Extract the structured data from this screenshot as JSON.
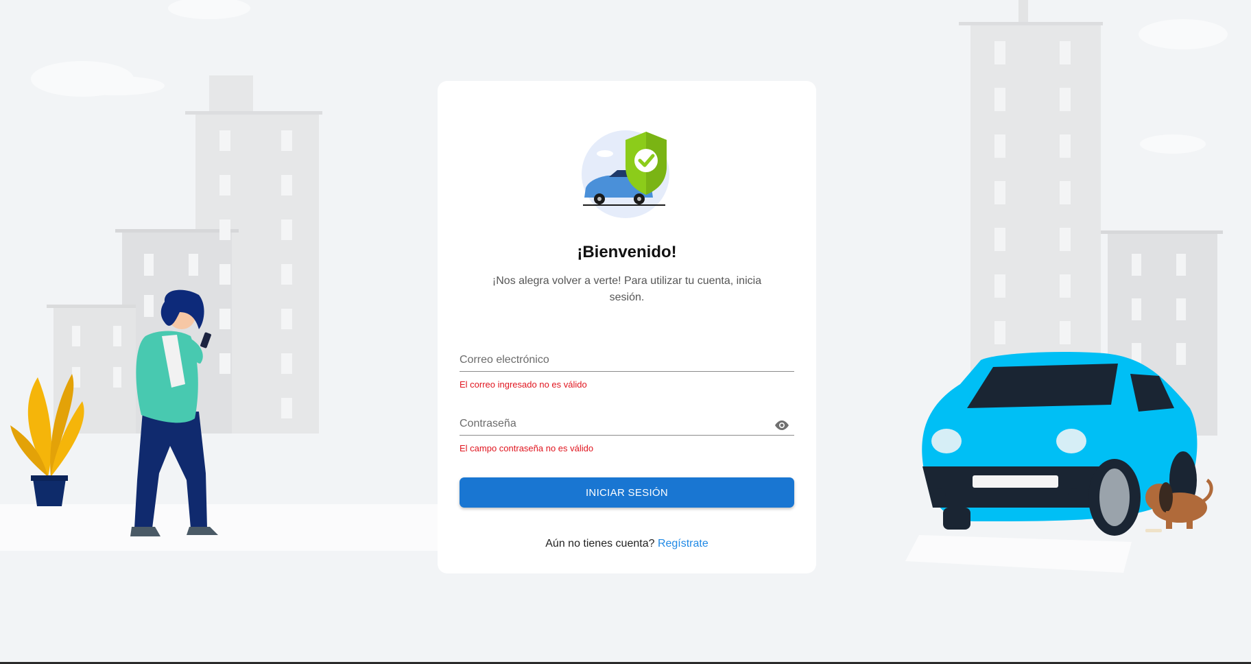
{
  "login": {
    "title": "¡Bienvenido!",
    "subtitle": "¡Nos alegra volver a verte! Para utilizar tu cuenta, inicia sesión.",
    "email": {
      "placeholder": "Correo electrónico",
      "value": "",
      "error": "El correo ingresado no es válido"
    },
    "password": {
      "placeholder": "Contraseña",
      "value": "",
      "error": "El campo contraseña no es válido"
    },
    "submit_label": "INICIAR SESIÓN",
    "register_prompt": "Aún no tienes cuenta?",
    "register_link": "Regístrate"
  },
  "icons": {
    "show_password": "eye-icon",
    "hero": "car-shield-check-icon"
  },
  "colors": {
    "primary": "#1976d2",
    "link": "#1e88e5",
    "error": "#e0141e",
    "shield": "#8ccc1a",
    "car": "#00c3ff",
    "background": "#f2f4f6"
  }
}
